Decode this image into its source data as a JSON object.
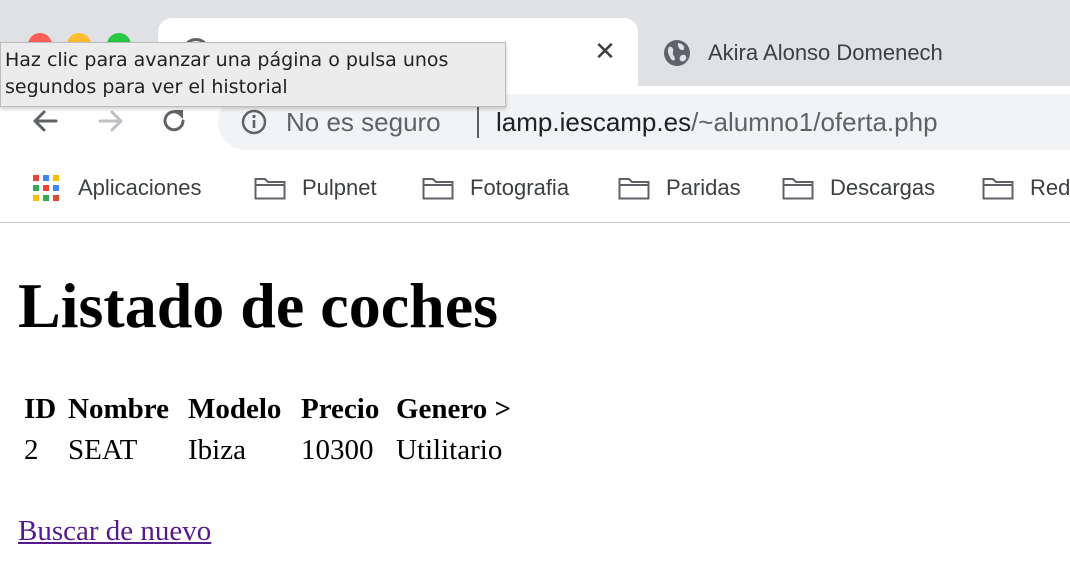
{
  "browser": {
    "active_tab": {
      "close_glyph": "✕"
    },
    "inactive_tab": {
      "title": "Akira Alonso Domenech"
    },
    "tooltip": {
      "line1": "Haz clic para avanzar una página o pulsa unos",
      "line2": "segundos para ver el historial"
    },
    "omnibox": {
      "security_label": "No es seguro",
      "url_host": "lamp.iescamp.es",
      "url_path": "/~alumno1/oferta.php"
    },
    "bookmarks": [
      {
        "label": "Aplicaciones",
        "icon": "apps-grid-icon"
      },
      {
        "label": "Pulpnet",
        "icon": "folder-icon"
      },
      {
        "label": "Fotografia",
        "icon": "folder-icon"
      },
      {
        "label": "Paridas",
        "icon": "folder-icon"
      },
      {
        "label": "Descargas",
        "icon": "folder-icon"
      },
      {
        "label": "Red",
        "icon": "folder-icon"
      }
    ]
  },
  "page": {
    "title": "Listado de coches",
    "table": {
      "headers": [
        "ID",
        "Nombre",
        "Modelo",
        "Precio",
        "Genero >"
      ],
      "rows": [
        [
          "2",
          "SEAT",
          "Ibiza",
          "10300",
          "Utilitario"
        ]
      ]
    },
    "link": "Buscar de nuevo"
  },
  "colors": {
    "chrome_bg": "#dfe1e5",
    "omnibox_bg": "#f1f3f4",
    "visited_link": "#551a8b"
  }
}
